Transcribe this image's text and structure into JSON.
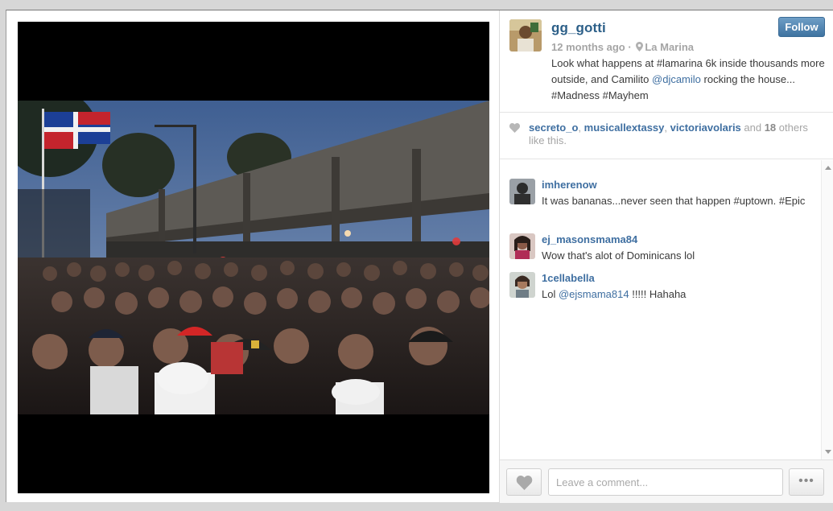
{
  "post": {
    "owner": "gg_gotti",
    "follow_label": "Follow",
    "time_ago": "12 months ago",
    "separator": "·",
    "location": "La Marina",
    "caption": {
      "part1": "Look what happens at ",
      "tag1": "#lamarina",
      "part2": " 6k inside thousands more outside, and Camilito ",
      "mention": "@djcamilo",
      "part3": " rocking the house... ",
      "tag2": "#Madness",
      "tag3": "#Mayhem"
    }
  },
  "likes": {
    "user1": "secreto_o",
    "user2": "musicallextassy",
    "user3": "victoriavolaris",
    "and_text": " and ",
    "count": "18",
    "suffix": " others like this."
  },
  "comments": [
    {
      "user": "imherenow",
      "text_a": "It was bananas...never seen that happen ",
      "tag_a": "#uptown",
      "text_b": ". ",
      "tag_b": "#Epic"
    },
    {
      "user": "ej_masonsmama84",
      "text_a": "Wow that's alot of Dominicans lol"
    },
    {
      "user": "1cellabella",
      "text_a": "Lol ",
      "mention": "@ejsmama814",
      "text_b": " !!!!! Hahaha"
    }
  ],
  "footer": {
    "comment_placeholder": "Leave a comment...",
    "more_label": "•••"
  },
  "colors": {
    "link": "#3f6fa1",
    "follow_button": "#3f73a1",
    "muted": "#a5a5a5"
  },
  "icons": [
    "location-pin-icon",
    "heart-icon",
    "more-options-icon",
    "scroll-up-arrow-icon",
    "scroll-down-arrow-icon"
  ]
}
